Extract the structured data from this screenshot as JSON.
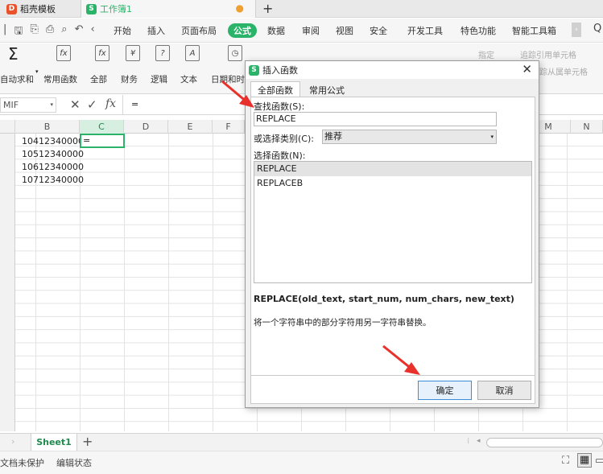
{
  "titlebar": {
    "tab1": "稻壳模板",
    "tab2": "工作簿1",
    "plus": "+"
  },
  "menu": {
    "start": "开始",
    "insert": "插入",
    "layout": "页面布局",
    "formula": "公式",
    "data": "数据",
    "review": "审阅",
    "view": "视图",
    "security": "安全",
    "dev": "开发工具",
    "special": "特色功能",
    "smart": "智能工具箱"
  },
  "ribbon": {
    "autosum": "自动求和",
    "common": "常用函数",
    "all": "全部",
    "finance": "财务",
    "logic": "逻辑",
    "text": "文本",
    "datetime": "日期和时",
    "trace_precedents": "追踪引用单元格",
    "trace_dependents": "追踪从属单元格",
    "specify": "指定"
  },
  "formula_bar": {
    "namebox": "MIF",
    "fx": "fx",
    "content": "="
  },
  "columns": [
    "B",
    "C",
    "D",
    "E",
    "F",
    "M",
    "N"
  ],
  "cells": {
    "b1": "10412340000",
    "b2": "10512340000",
    "b3": "10612340000",
    "b4": "10712340000",
    "c1": "="
  },
  "sheet_tab": "Sheet1",
  "status": {
    "protect": "文档未保护",
    "edit": "编辑状态"
  },
  "dialog": {
    "title": "插入函数",
    "tab_all": "全部函数",
    "tab_common": "常用公式",
    "search_label": "查找函数(S):",
    "search_value": "REPLACE",
    "category_label": "或选择类别(C):",
    "category_value": "推荐",
    "select_label": "选择函数(N):",
    "functions": [
      "REPLACE",
      "REPLACEB"
    ],
    "signature": "REPLACE(old_text, start_num, num_chars, new_text)",
    "description": "将一个字符串中的部分字符用另一字符串替换。",
    "ok": "确定",
    "cancel": "取消"
  },
  "colors": {
    "accent_green": "#2bb36a",
    "arrow_red": "#e8312b",
    "primary_border": "#3c8fd6"
  }
}
